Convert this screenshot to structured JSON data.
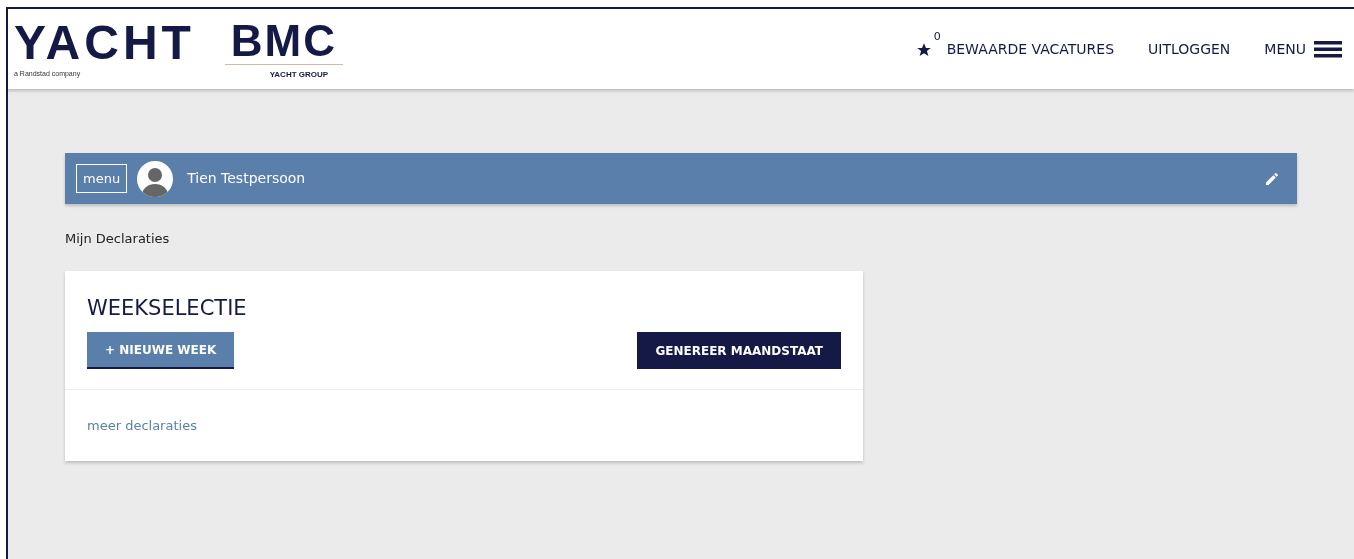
{
  "header": {
    "logo": {
      "brand": "YACHT",
      "tagline": "a Randstad company",
      "partner": "BMC",
      "partner_tagline": "YACHT GROUP"
    },
    "saved_count": "0",
    "nav": [
      "BEWAARDE VACATURES",
      "UITLOGGEN"
    ],
    "menu": "MENU"
  },
  "profile_bar": {
    "menu_button": "menu",
    "user_name": "Tien Testpersoon"
  },
  "breadcrumb": "Mijn Declaraties",
  "card": {
    "title": "WEEKSELECTIE",
    "buttons": [
      {
        "label": "+ NIEUWE WEEK",
        "kind": "secondary"
      },
      {
        "label": "GENEREER MAANDSTAAT",
        "kind": "primary"
      }
    ],
    "link": "meer declaraties"
  }
}
